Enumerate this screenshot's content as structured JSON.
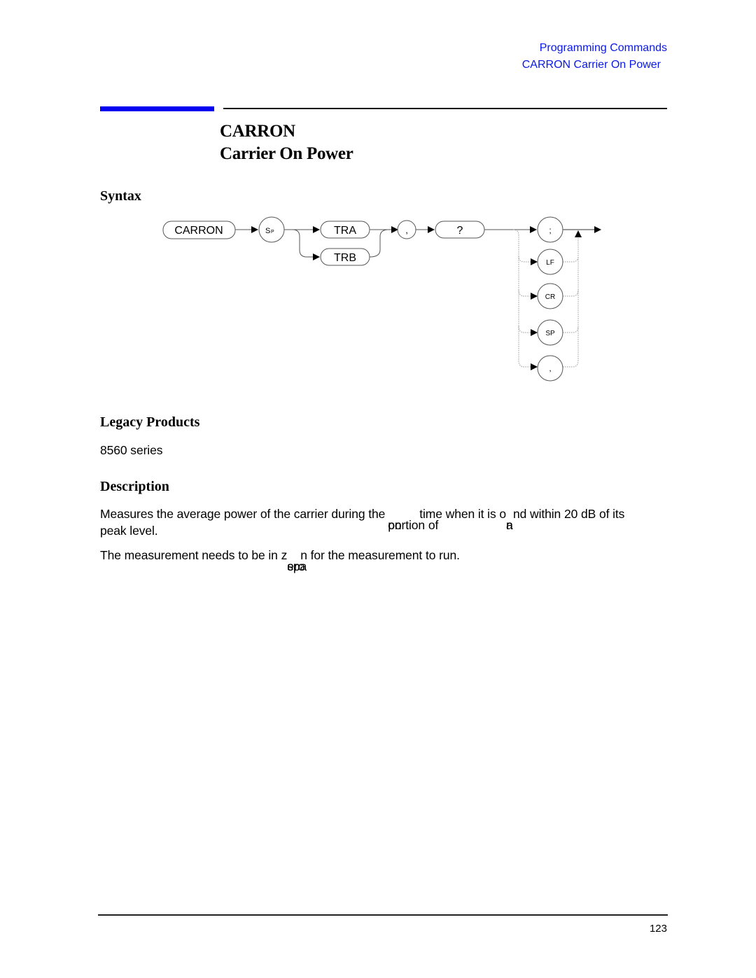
{
  "header": {
    "section": "Programming Commands",
    "subsection": "CARRON Carrier On Power"
  },
  "title": {
    "command": "CARRON",
    "name": "Carrier On Power"
  },
  "syntax": {
    "heading": "Syntax",
    "diagram": {
      "command": "CARRON",
      "separator": "SP",
      "sep_sub": "P",
      "sep_main": "S",
      "options": [
        "TRA",
        "TRB"
      ],
      "comma": ",",
      "query": "?",
      "terminators": [
        ";",
        "LF",
        "CR",
        "SP",
        ","
      ]
    }
  },
  "legacy": {
    "heading": "Legacy Products",
    "text": "8560 series"
  },
  "description": {
    "heading": "Description",
    "para1_start": "Measures the average power of the carrier during the",
    "para1_overlap_a": "on",
    "para1_overlap_b": "portion of",
    "para1_mid": "time when it is o",
    "para1_overlap_c": "n",
    "para1_overlap_d": "a",
    "para1_end": "nd within 20 dB of its",
    "para1_line2": "peak level.",
    "para2_start": "The measurement needs to be in z",
    "para2_overlap_a": "ero",
    "para2_overlap_b": "spa",
    "para2_end": "n for the measurement to run."
  },
  "footer": {
    "page_number": "123"
  }
}
